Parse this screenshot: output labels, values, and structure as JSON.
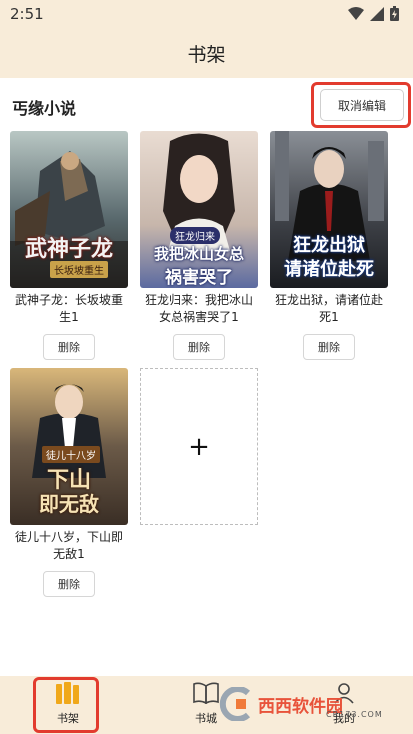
{
  "status_bar": {
    "time": "2:51"
  },
  "header": {
    "title": "书架"
  },
  "shelf": {
    "store_name": "丐缘小说",
    "cancel_edit_label": "取消编辑",
    "add_label": "+"
  },
  "books": [
    {
      "title": "武神子龙：长坂坡重生1",
      "cover_text": "武神子龙",
      "cover_sub": "长坂坡重生",
      "delete_label": "删除"
    },
    {
      "title": "狂龙归来：我把冰山女总祸害哭了1",
      "cover_text": "我把冰山女总",
      "cover_sub": "祸害哭了",
      "cover_tag": "狂龙归来",
      "delete_label": "删除"
    },
    {
      "title": "狂龙出狱，请诸位赴死1",
      "cover_text": "狂龙出狱",
      "cover_sub": "请诸位赴死",
      "delete_label": "删除"
    },
    {
      "title": "徒儿十八岁，下山即无敌1",
      "cover_text": "下山",
      "cover_sub": "即无敌",
      "cover_tag": "徒儿十八岁",
      "delete_label": "删除"
    }
  ],
  "tabs": [
    {
      "label": "书架",
      "icon": "bookshelf-icon",
      "active": true
    },
    {
      "label": "书城",
      "icon": "book-icon"
    },
    {
      "label": "我的",
      "icon": "user-icon"
    }
  ],
  "watermark": {
    "brand": "西西软件园",
    "site": "CR173.COM"
  },
  "colors": {
    "header_bg": "#f8ecd9",
    "accent": "#f0a81a",
    "highlight": "#e23b2e"
  }
}
